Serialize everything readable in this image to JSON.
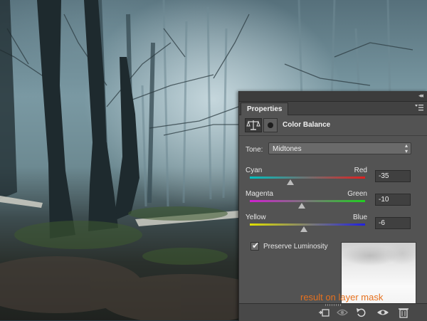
{
  "panel": {
    "tab_label": "Properties",
    "adjustment_title": "Color Balance",
    "tone": {
      "label": "Tone:",
      "selected": "Midtones"
    },
    "sliders": [
      {
        "left_label": "Cyan",
        "right_label": "Red",
        "value": "-35",
        "position": 0.35,
        "gradient_from": "#00c0c0",
        "gradient_to": "#e02020"
      },
      {
        "left_label": "Magenta",
        "right_label": "Green",
        "value": "-10",
        "position": 0.45,
        "gradient_from": "#d020d0",
        "gradient_to": "#20d020"
      },
      {
        "left_label": "Yellow",
        "right_label": "Blue",
        "value": "-6",
        "position": 0.47,
        "gradient_from": "#e0e000",
        "gradient_to": "#2020e0"
      }
    ],
    "preserve_luminosity": {
      "label": "Preserve Luminosity",
      "checked": true
    },
    "bottom_icons": [
      "clip-to-layer-icon",
      "view-previous-state-icon",
      "reset-icon",
      "visibility-eye-icon",
      "trash-icon"
    ]
  },
  "caption": "result on layer mask"
}
